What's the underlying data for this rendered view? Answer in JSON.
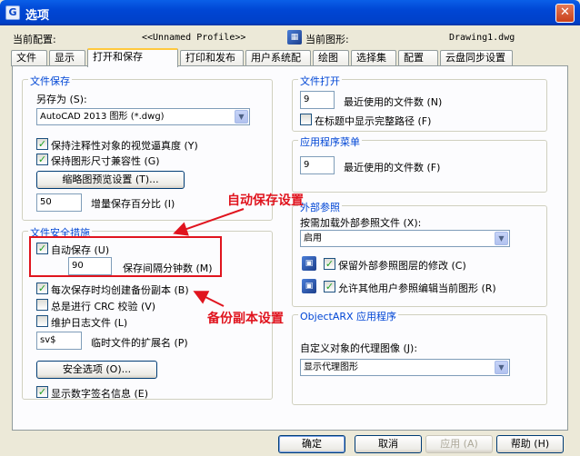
{
  "window": {
    "title": "选项",
    "close": "✕"
  },
  "header": {
    "profile_label": "当前配置:",
    "profile_value": "<<Unnamed Profile>>",
    "drawing_label": "当前图形:",
    "drawing_value": "Drawing1.dwg"
  },
  "tabs": [
    "文件",
    "显示",
    "打开和保存",
    "打印和发布",
    "用户系统配置",
    "绘图",
    "选择集",
    "配置",
    "云盘同步设置"
  ],
  "file_save": {
    "title": "文件保存",
    "save_as_label": "另存为 (S):",
    "save_as_value": "AutoCAD 2013 图形 (*.dwg)",
    "annot_label": "保持注释性对象的视觉逼真度 (Y)",
    "annot_checked": true,
    "size_label": "保持图形尺寸兼容性 (G)",
    "size_checked": true,
    "thumb_button": "缩略图预览设置 (T)...",
    "incr_value": "50",
    "incr_label": "增量保存百分比 (I)"
  },
  "file_safety": {
    "title": "文件安全措施",
    "autosave_label": "自动保存 (U)",
    "autosave_checked": true,
    "interval_value": "90",
    "interval_label": "保存间隔分钟数 (M)",
    "backup_label": "每次保存时均创建备份副本 (B)",
    "backup_checked": true,
    "crc_label": "总是进行 CRC 校验 (V)",
    "crc_checked": false,
    "log_label": "维护日志文件 (L)",
    "log_checked": false,
    "ext_value": "sv$",
    "ext_label": "临时文件的扩展名 (P)",
    "security_button": "安全选项 (O)...",
    "sig_label": "显示数字签名信息 (E)",
    "sig_checked": true
  },
  "file_open": {
    "title": "文件打开",
    "recent_value": "9",
    "recent_label": "最近使用的文件数 (N)",
    "fullpath_label": "在标题中显示完整路径 (F)",
    "fullpath_checked": false
  },
  "app_menu": {
    "title": "应用程序菜单",
    "recent_value": "9",
    "recent_label": "最近使用的文件数 (F)"
  },
  "xref": {
    "title": "外部参照",
    "demand_label": "按需加载外部参照文件 (X):",
    "demand_value": "启用",
    "retain_label": "保留外部参照图层的修改 (C)",
    "retain_checked": true,
    "allow_label": "允许其他用户参照编辑当前图形 (R)",
    "allow_checked": true
  },
  "arx": {
    "title": "ObjectARX 应用程序",
    "proxy_label": "自定义对象的代理图像 (J):",
    "proxy_value": "显示代理图形"
  },
  "annotations": {
    "autosave_note": "自动保存设置",
    "backup_note": "备份副本设置"
  },
  "buttons": {
    "ok": "确定",
    "cancel": "取消",
    "apply": "应用 (A)",
    "help": "帮助 (H)"
  }
}
